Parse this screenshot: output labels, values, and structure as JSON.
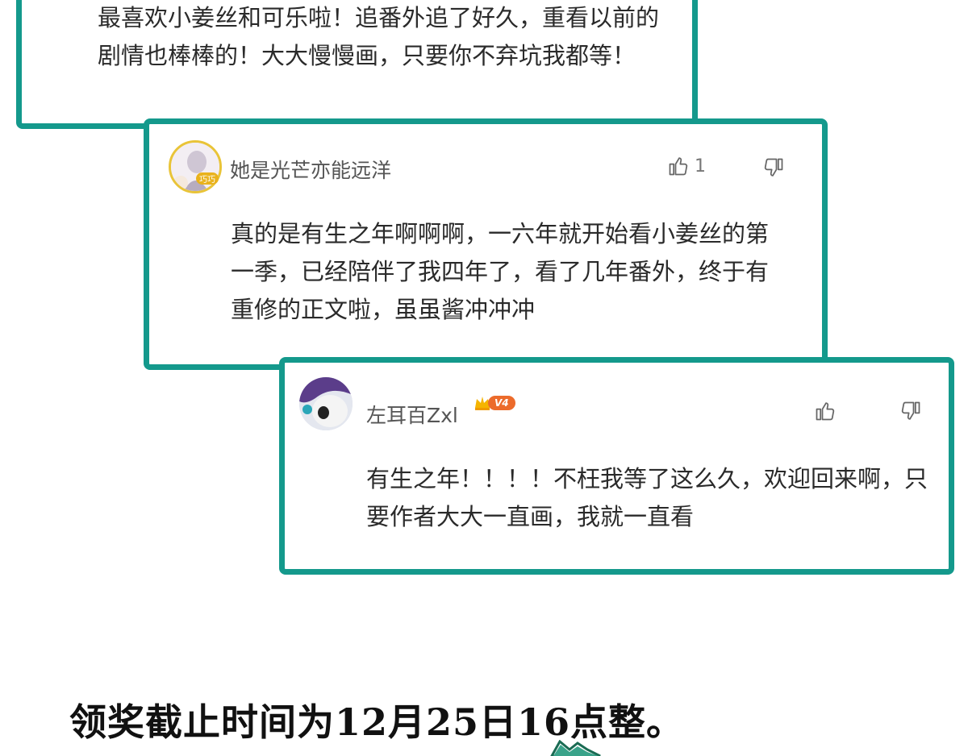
{
  "comments": [
    {
      "text": "最喜欢小姜丝和可乐啦！追番外追了好久，重看以前的剧情也棒棒的！大大慢慢画，只要你不弃坑我都等！"
    },
    {
      "username": "她是光芒亦能远洋",
      "avatar_frame": "巧巧",
      "likes": "1",
      "text": "真的是有生之年啊啊啊，一六年就开始看小姜丝的第一季，已经陪伴了我四年了，看了几年番外，终于有重修的正文啦，虽虽酱冲冲冲"
    },
    {
      "username": "左耳百Zxl",
      "vip_level": "V4",
      "text": "有生之年！！！！不枉我等了这么久，欢迎回来啊，只要作者大大一直画，我就一直看"
    }
  ],
  "footer": {
    "deadline": "领奖截止时间为12月25日16点整。"
  },
  "colors": {
    "card_border": "#14998c",
    "avatar_frame": "#e9c438",
    "vip_badge": "#ec6b2b"
  }
}
